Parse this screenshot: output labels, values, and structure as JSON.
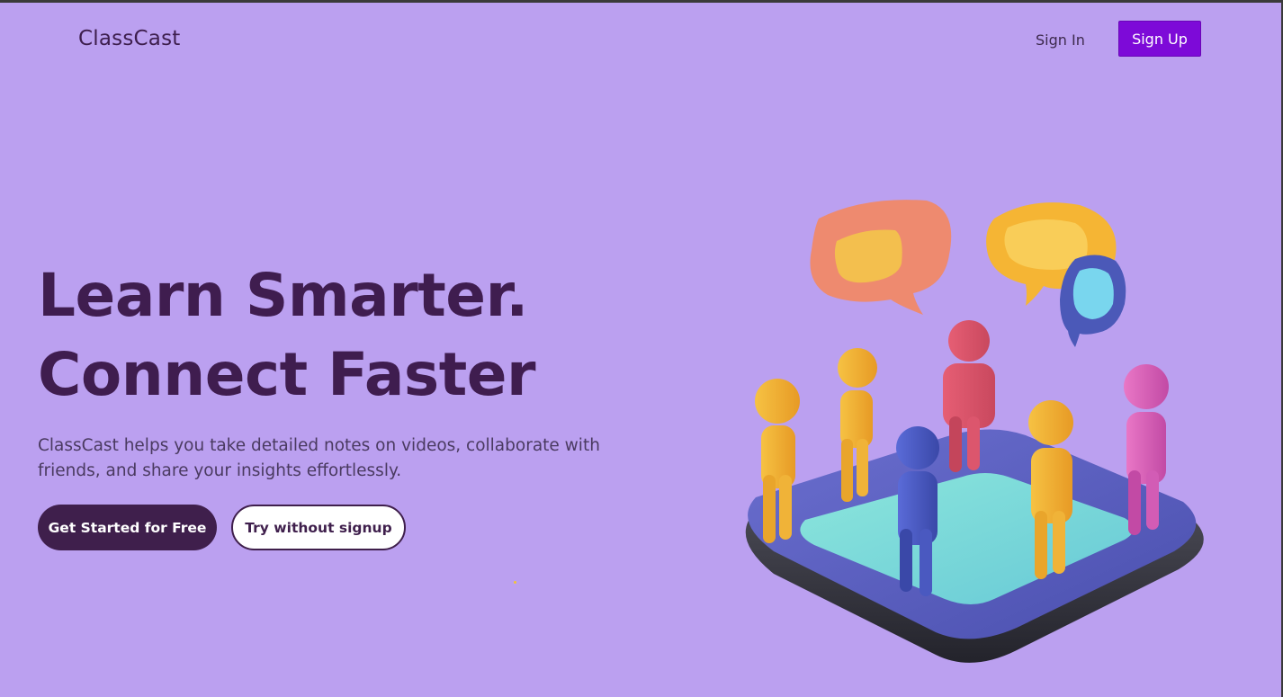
{
  "header": {
    "brand": "ClassCast",
    "signin_label": "Sign In",
    "signup_label": "Sign Up"
  },
  "hero": {
    "headline_line1": "Learn Smarter.",
    "headline_line2": "Connect Faster",
    "description": "ClassCast helps you take detailed notes on videos, collaborate with friends, and share your insights effortlessly.",
    "primary_cta": "Get Started for Free",
    "secondary_cta": "Try without signup"
  },
  "illustration": {
    "name": "community-people-chat-illustration"
  },
  "colors": {
    "background": "#bba0f0",
    "brand_text": "#3d1e4d",
    "signup_button": "#7d0ad8",
    "primary_button": "#3f1f4c"
  }
}
